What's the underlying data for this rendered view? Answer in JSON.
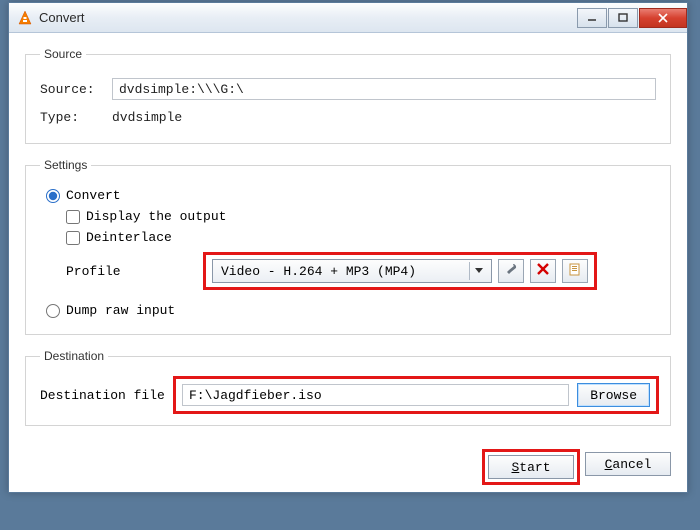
{
  "window": {
    "title": "Convert"
  },
  "source": {
    "legend": "Source",
    "source_label": "Source:",
    "source_value": "dvdsimple:\\\\\\G:\\",
    "type_label": "Type:",
    "type_value": "dvdsimple"
  },
  "settings": {
    "legend": "Settings",
    "convert_label": "Convert",
    "display_output_label": "Display the output",
    "deinterlace_label": "Deinterlace",
    "profile_label": "Profile",
    "profile_value": "Video - H.264 + MP3 (MP4)",
    "dump_label": "Dump raw input"
  },
  "destination": {
    "legend": "Destination",
    "file_label": "Destination file",
    "file_value": "F:\\Jagdfieber.iso",
    "browse_label": "Browse"
  },
  "footer": {
    "start_label": "Start",
    "start_u": "S",
    "cancel_label": "Cancel",
    "cancel_u": "C"
  },
  "icons": {
    "wrench": "wrench-icon",
    "delete": "delete-icon",
    "new": "new-profile-icon"
  }
}
